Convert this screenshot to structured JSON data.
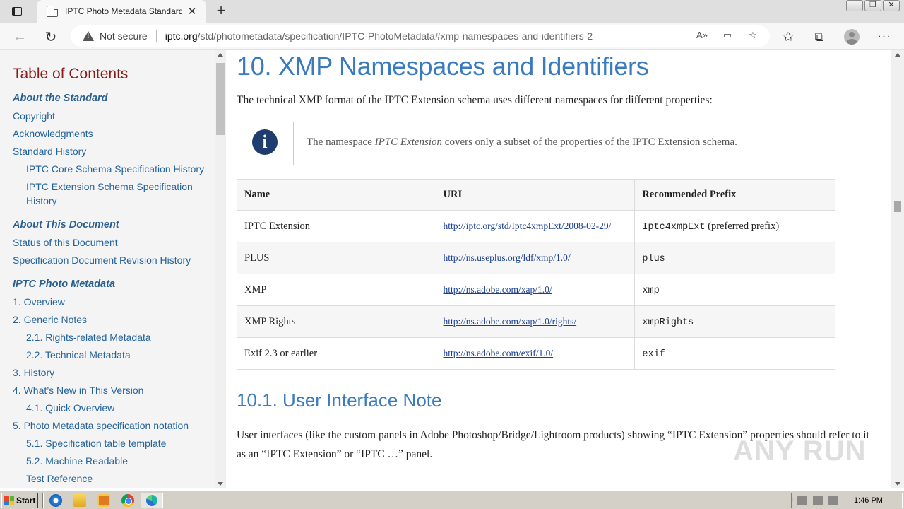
{
  "browser": {
    "tab_title": "IPTC Photo Metadata Standard",
    "tab_close": "✕",
    "new_tab": "+",
    "security_label": "Not secure",
    "url_domain": "iptc.org",
    "url_path": "/std/photometadata/specification/IPTC-PhotoMetadata#xmp-namespaces-and-identifiers-2",
    "window_controls": [
      "_",
      "❐",
      "✕"
    ]
  },
  "toc": {
    "title": "Table of Contents",
    "items": [
      {
        "label": "About the Standard",
        "type": "head"
      },
      {
        "label": "Copyright",
        "type": "l1"
      },
      {
        "label": "Acknowledgments",
        "type": "l1"
      },
      {
        "label": "Standard History",
        "type": "l1"
      },
      {
        "label": "IPTC Core Schema Specification History",
        "type": "l2"
      },
      {
        "label": "IPTC Extension Schema Specification History",
        "type": "l2"
      },
      {
        "label": "About This Document",
        "type": "head"
      },
      {
        "label": "Status of this Document",
        "type": "l1"
      },
      {
        "label": "Specification Document Revision History",
        "type": "l1"
      },
      {
        "label": "IPTC Photo Metadata",
        "type": "head"
      },
      {
        "label": "1. Overview",
        "type": "l1"
      },
      {
        "label": "2. Generic Notes",
        "type": "l1"
      },
      {
        "label": "2.1. Rights-related Metadata",
        "type": "l2"
      },
      {
        "label": "2.2. Technical Metadata",
        "type": "l2"
      },
      {
        "label": "3. History",
        "type": "l1"
      },
      {
        "label": "4. What’s New in This Version",
        "type": "l1"
      },
      {
        "label": "4.1. Quick Overview",
        "type": "l2"
      },
      {
        "label": "5. Photo Metadata specification notation",
        "type": "l1"
      },
      {
        "label": "5.1. Specification table template",
        "type": "l2"
      },
      {
        "label": "5.2. Machine Readable",
        "type": "l2"
      },
      {
        "label": "Test Reference",
        "type": "l2"
      }
    ]
  },
  "content": {
    "heading": "10. XMP Namespaces and Identifiers",
    "intro": "The technical XMP format of the IPTC Extension schema uses different namespaces for different properties:",
    "note_before": "The namespace ",
    "note_em": "IPTC Extension",
    "note_after": " covers only a subset of the properties of the IPTC Extension schema.",
    "table": {
      "headers": [
        "Name",
        "URI",
        "Recommended Prefix"
      ],
      "rows": [
        {
          "name": "IPTC Extension",
          "uri": "http://iptc.org/std/Iptc4xmpExt/2008-02-29/",
          "prefix": "Iptc4xmpExt",
          "prefix_note": " (preferred prefix)"
        },
        {
          "name": "PLUS",
          "uri": "http://ns.useplus.org/ldf/xmp/1.0/",
          "prefix": "plus",
          "prefix_note": ""
        },
        {
          "name": "XMP",
          "uri": "http://ns.adobe.com/xap/1.0/",
          "prefix": "xmp",
          "prefix_note": ""
        },
        {
          "name": "XMP Rights",
          "uri": "http://ns.adobe.com/xap/1.0/rights/",
          "prefix": "xmpRights",
          "prefix_note": ""
        },
        {
          "name": "Exif 2.3 or earlier",
          "uri": "http://ns.adobe.com/exif/1.0/",
          "prefix": "exif",
          "prefix_note": ""
        }
      ]
    },
    "subheading": "10.1. User Interface Note",
    "ui_note": "User interfaces (like the custom panels in Adobe Photoshop/Bridge/Lightroom products) showing “IPTC Extension” properties should refer to it as an “IPTC Extension” or “IPTC …” panel."
  },
  "watermark": "ANY RUN",
  "taskbar": {
    "start_label": "Start",
    "clock": "1:46 PM"
  },
  "icons": {
    "info": "info-icon",
    "refresh": "refresh-icon",
    "back": "back-arrow-icon"
  }
}
